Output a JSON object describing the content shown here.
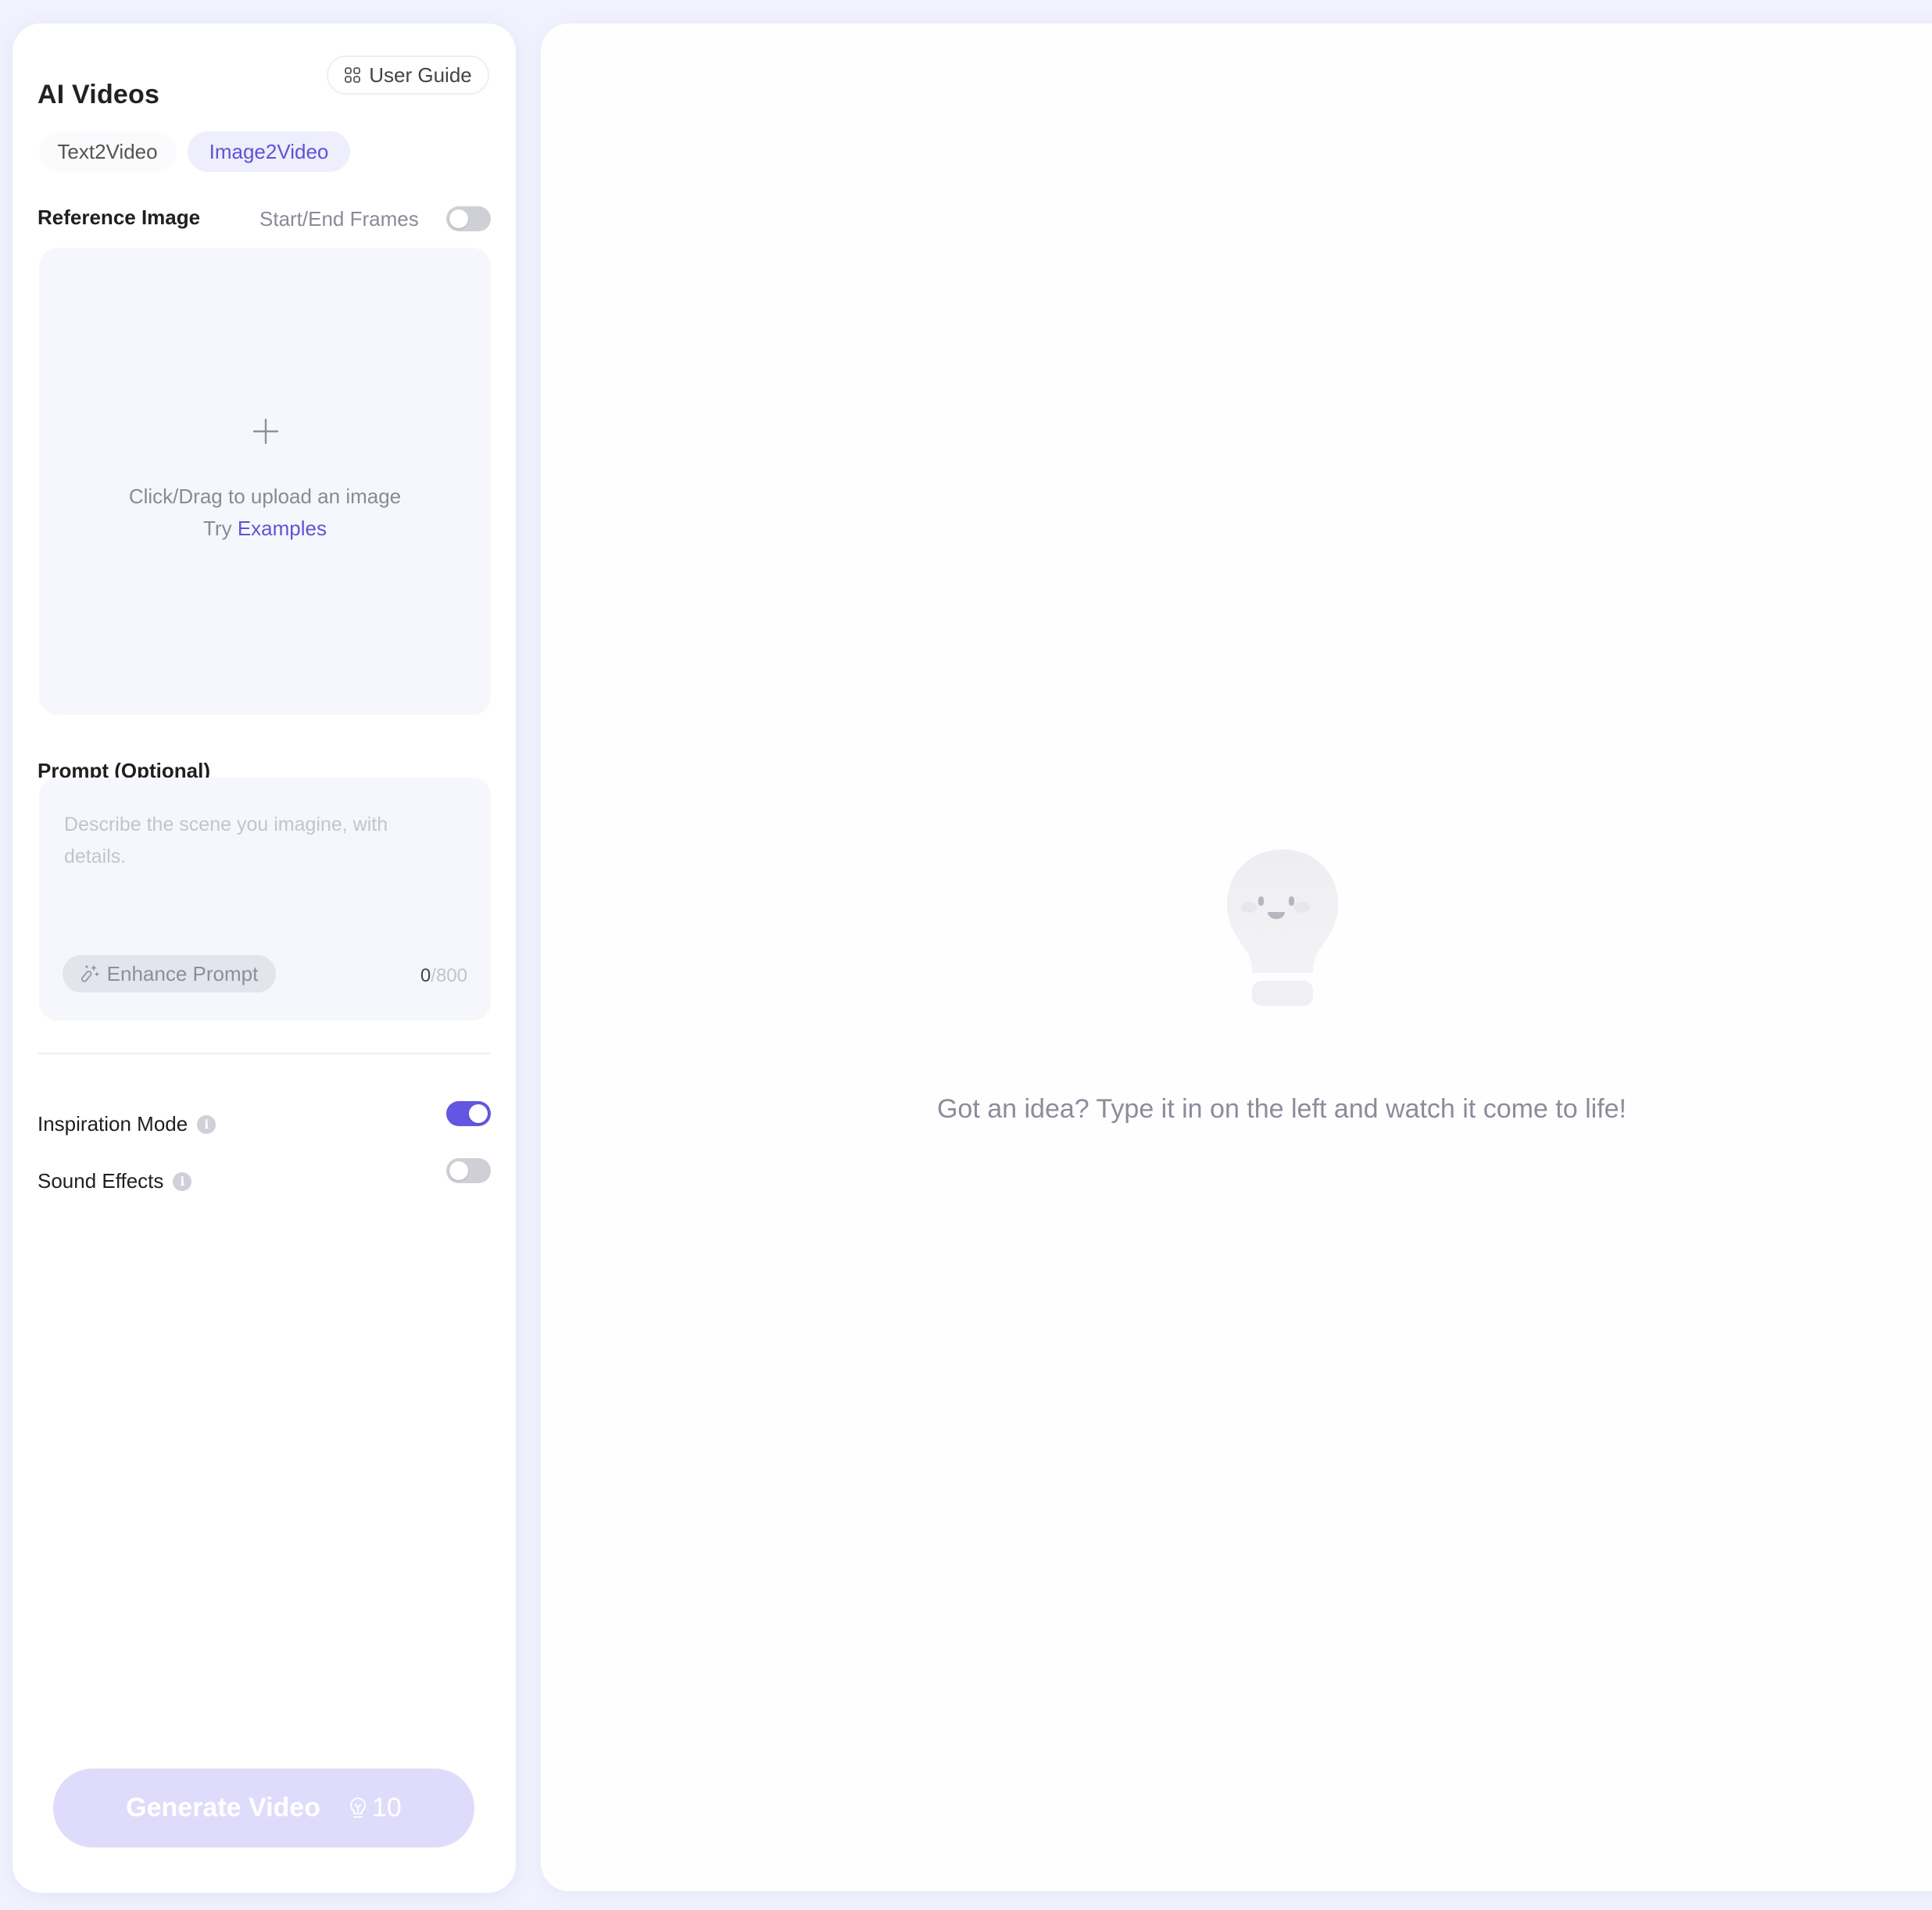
{
  "header": {
    "title": "AI Videos",
    "user_guide_label": "User Guide",
    "user_guide_icon": "grid-icon"
  },
  "tabs": [
    {
      "label": "Text2Video",
      "active": false
    },
    {
      "label": "Image2Video",
      "active": true
    }
  ],
  "reference_image": {
    "label": "Reference Image",
    "start_end_frames_label": "Start/End Frames",
    "start_end_frames_enabled": false,
    "upload_icon": "plus-icon",
    "upload_text": "Click/Drag to upload an image",
    "try_prefix": "Try ",
    "examples_link": "Examples"
  },
  "prompt": {
    "label": "Prompt (Optional)",
    "value": "",
    "placeholder": "Describe the scene you imagine, with details.",
    "enhance_label": "Enhance Prompt",
    "enhance_icon": "magic-wand-icon",
    "char_count": "0",
    "char_limit": "/800"
  },
  "options": {
    "inspiration_mode": {
      "label": "Inspiration Mode",
      "enabled": true,
      "info_icon": "info-icon"
    },
    "sound_effects": {
      "label": "Sound Effects",
      "enabled": false,
      "info_icon": "info-icon"
    }
  },
  "generate": {
    "label": "Generate Video",
    "credit_icon": "lightbulb-icon",
    "cost": "10",
    "disabled": true
  },
  "empty_state": {
    "illustration": "smiling-lightbulb-icon",
    "message": "Got an idea? Type it in on the left and watch it come to life!"
  },
  "colors": {
    "accent": "#6356e0",
    "accent_text": "#6152d4",
    "accent_soft": "#eeeefd",
    "generate_disabled": "#dfdcfb",
    "page_bg": "#f1f2fd"
  }
}
